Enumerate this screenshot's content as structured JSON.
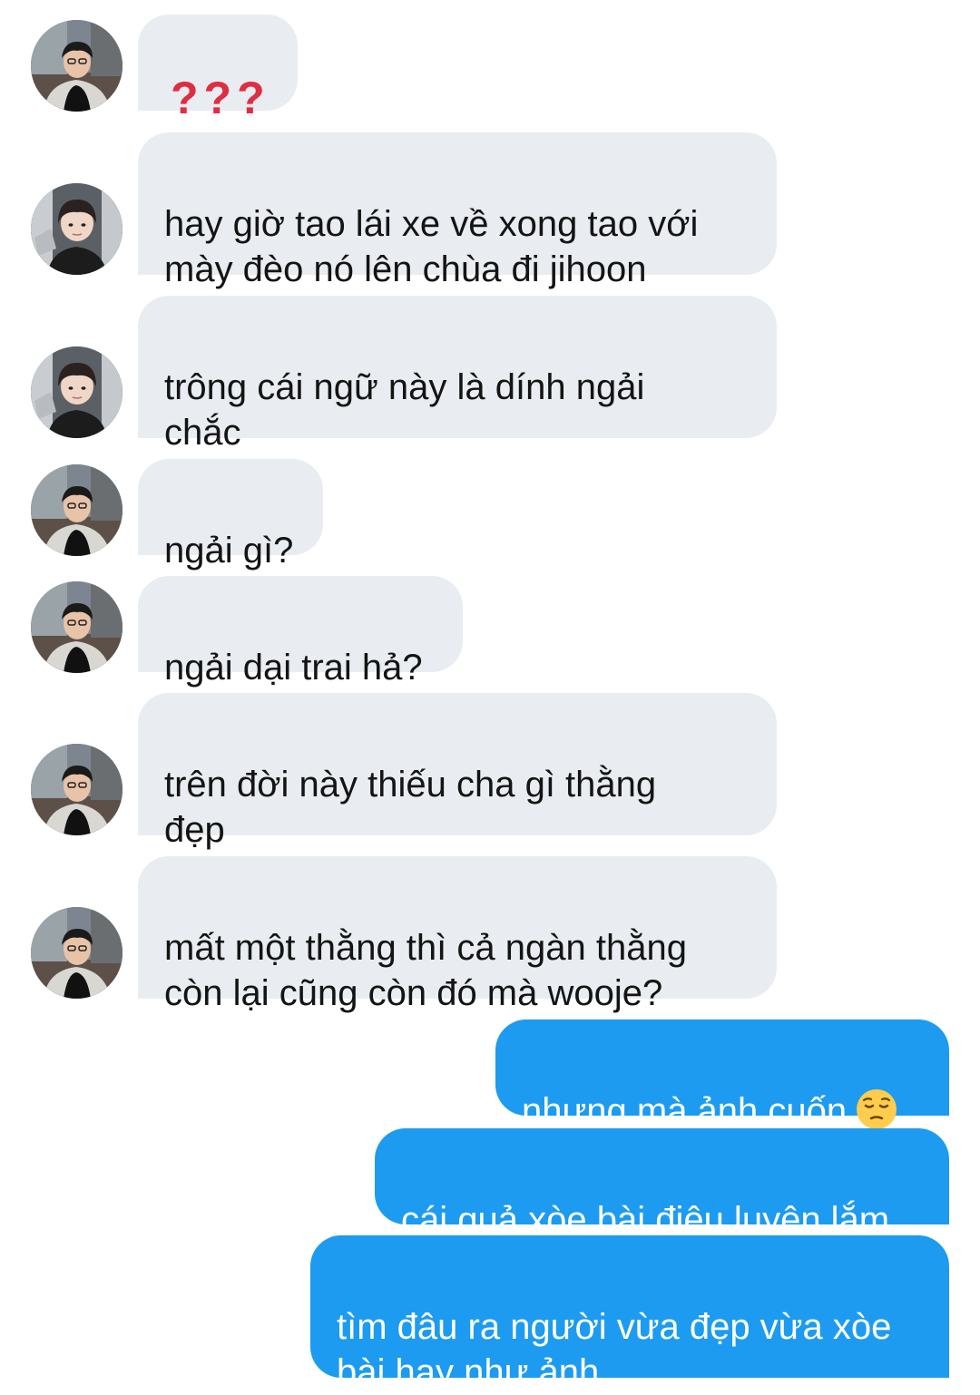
{
  "conversation": {
    "messages": [
      {
        "direction": "incoming",
        "text": "???",
        "avatar": "avatar-a"
      },
      {
        "direction": "incoming",
        "text": "hay giờ tao lái xe về xong tao với\nmày đèo nó lên chùa đi jihoon",
        "avatar": "avatar-b"
      },
      {
        "direction": "incoming",
        "text": "trông cái ngữ này là dính ngải\nchắc",
        "avatar": "avatar-b"
      },
      {
        "direction": "incoming",
        "text": "ngải gì?",
        "avatar": "avatar-a"
      },
      {
        "direction": "incoming",
        "text": "ngải dại trai hả?",
        "avatar": "avatar-a"
      },
      {
        "direction": "incoming",
        "text": "trên đời này thiếu cha gì thằng\nđẹp",
        "avatar": "avatar-a"
      },
      {
        "direction": "incoming",
        "text": "mất một thằng thì cả ngàn thằng\ncòn lại cũng còn đó mà wooje?",
        "avatar": "avatar-a"
      },
      {
        "direction": "outgoing",
        "text": "nhưng mà ảnh cuốn",
        "emoji": "pensive-face-icon"
      },
      {
        "direction": "outgoing",
        "text": "cái quả xòe bài điêu luyện lắm"
      },
      {
        "direction": "outgoing",
        "text": "tìm đâu ra người vừa đẹp vừa xòe\nbài hay như ảnh"
      }
    ]
  },
  "colors": {
    "incoming_bubble": "#e9edf1",
    "outgoing_bubble": "#1d9bf0",
    "question_marks": "#dd2e44"
  }
}
